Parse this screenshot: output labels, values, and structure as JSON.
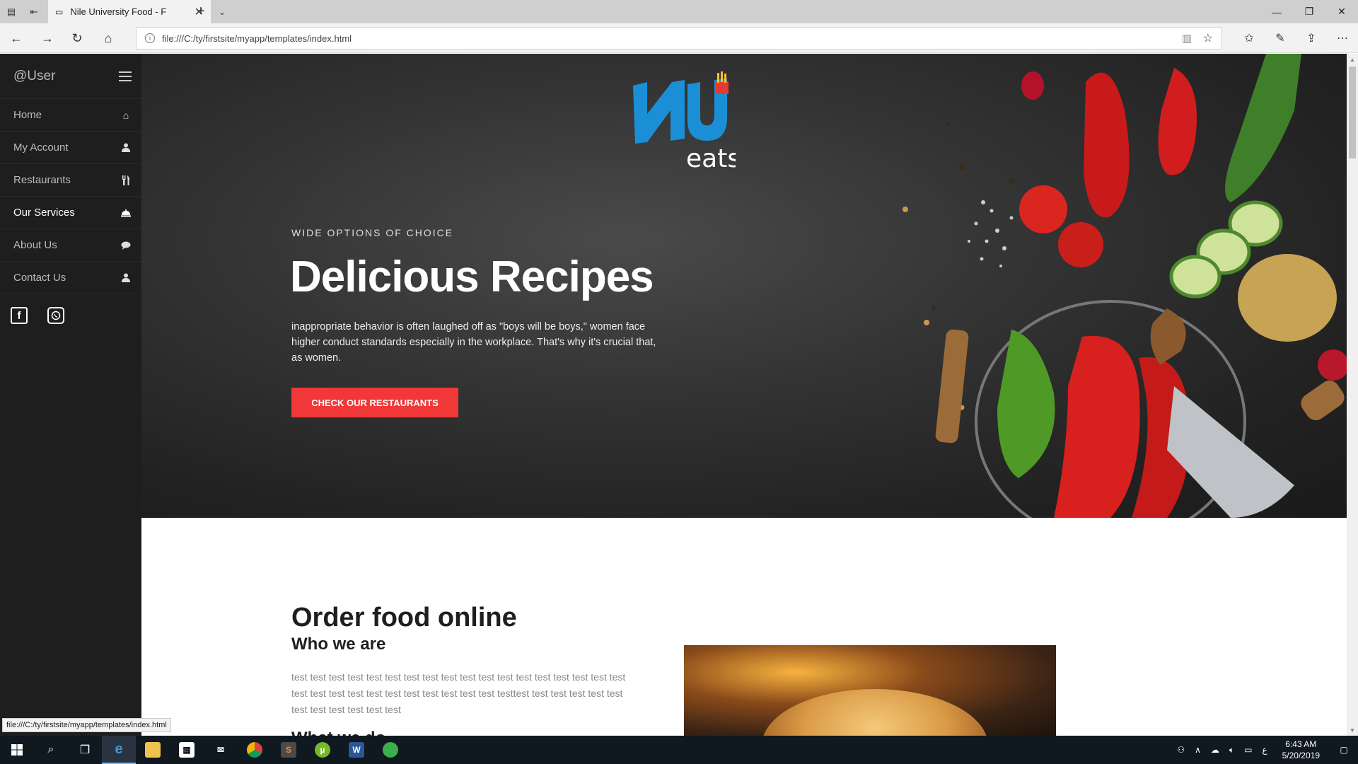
{
  "browser": {
    "tab_title": "Nile University Food - F",
    "url": "file:///C:/ty/firstsite/myapp/templates/index.html",
    "status_tip": "file:///C:/ty/firstsite/myapp/templates/index.html"
  },
  "sidebar": {
    "user": "@User",
    "items": [
      {
        "label": "Home",
        "icon": "home-icon"
      },
      {
        "label": "My Account",
        "icon": "user-icon"
      },
      {
        "label": "Restaurants",
        "icon": "cutlery-icon"
      },
      {
        "label": "Our Services",
        "icon": "cloche-icon"
      },
      {
        "label": "About Us",
        "icon": "chat-icon"
      },
      {
        "label": "Contact Us",
        "icon": "user-icon"
      }
    ],
    "social": [
      "facebook-icon",
      "whatsapp-icon"
    ]
  },
  "hero": {
    "logo_main": "NU",
    "logo_sub": "eats",
    "kicker": "WIDE OPTIONS OF CHOICE",
    "title": "Delicious Recipes",
    "text": "inappropriate behavior is often laughed off as \"boys will be boys,\" women face higher conduct standards especially in the workplace. That's why it's crucial that, as women.",
    "button": "CHECK OUR RESTAURANTS"
  },
  "content": {
    "title": "Order food online",
    "subtitle": "Who we are",
    "text": "test test test test test test test test test test test test test test test test test test test test test test test test test test test test test testtest test test test test test test test test test test test",
    "next_heading": "What we do"
  },
  "taskbar": {
    "time": "6:43 AM",
    "date": "5/20/2019",
    "lang": "ع"
  },
  "colors": {
    "accent": "#f03838",
    "sidebar_bg": "#1e1e1e",
    "logo_blue": "#1a8fd6"
  }
}
